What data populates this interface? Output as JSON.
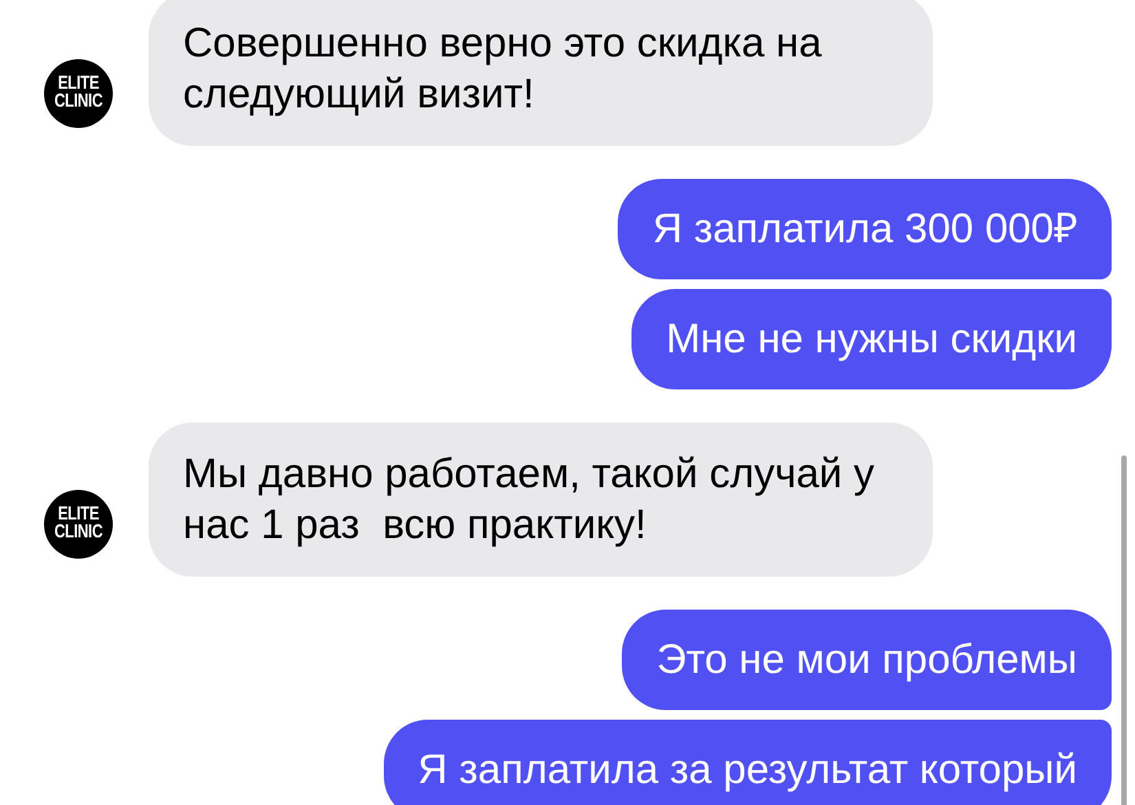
{
  "messages": [
    {
      "kind": "incoming",
      "avatar": {
        "line_1": "ELITE",
        "line_2": "CLINIC"
      },
      "text": "Совершенно верно это скидка на следующий визит!"
    },
    {
      "kind": "outgoing",
      "text": "Я заплатила 300 000₽"
    },
    {
      "kind": "outgoing",
      "text": "Мне не нужны скидки"
    },
    {
      "kind": "incoming",
      "avatar": {
        "line_1": "ELITE",
        "line_2": "CLINIC"
      },
      "text": "Мы давно работаем, такой случай у нас 1 раз  всю практику!"
    },
    {
      "kind": "outgoing",
      "text": "Это не мои проблемы"
    },
    {
      "kind": "outgoing",
      "text": "Я заплатила за результат который"
    }
  ]
}
